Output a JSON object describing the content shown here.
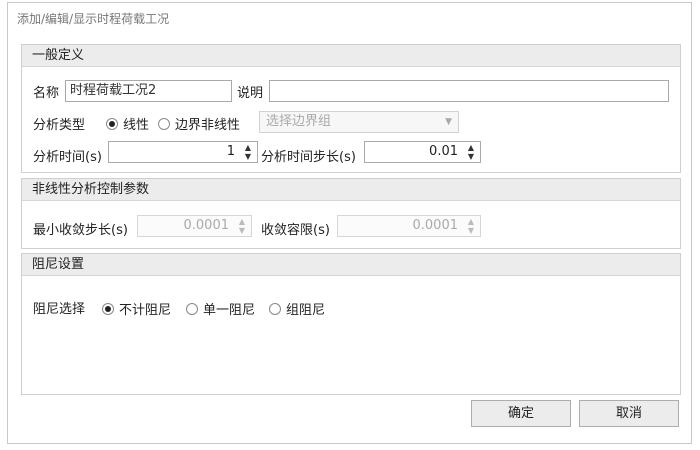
{
  "window": {
    "title": "添加/编辑/显示时程荷载工况"
  },
  "general": {
    "header": "一般定义",
    "name_label": "名称",
    "name_value": "时程荷载工况2",
    "desc_label": "说明",
    "desc_value": "",
    "analysis_type_label": "分析类型",
    "linear_label": "线性",
    "boundary_nonlinear_label": "边界非线性",
    "boundary_group_placeholder": "选择边界组",
    "analysis_time_label": "分析时间(s)",
    "analysis_time_value": "1",
    "time_step_label": "分析时间步长(s)",
    "time_step_value": "0.01"
  },
  "nonlinear": {
    "header": "非线性分析控制参数",
    "min_step_label": "最小收敛步长(s)",
    "min_step_value": "0.0001",
    "tolerance_label": "收敛容限(s)",
    "tolerance_value": "0.0001"
  },
  "damping": {
    "header": "阻尼设置",
    "select_label": "阻尼选择",
    "options": [
      "不计阻尼",
      "单一阻尼",
      "组阻尼"
    ],
    "selected": "不计阻尼"
  },
  "buttons": {
    "ok": "确定",
    "cancel": "取消"
  }
}
